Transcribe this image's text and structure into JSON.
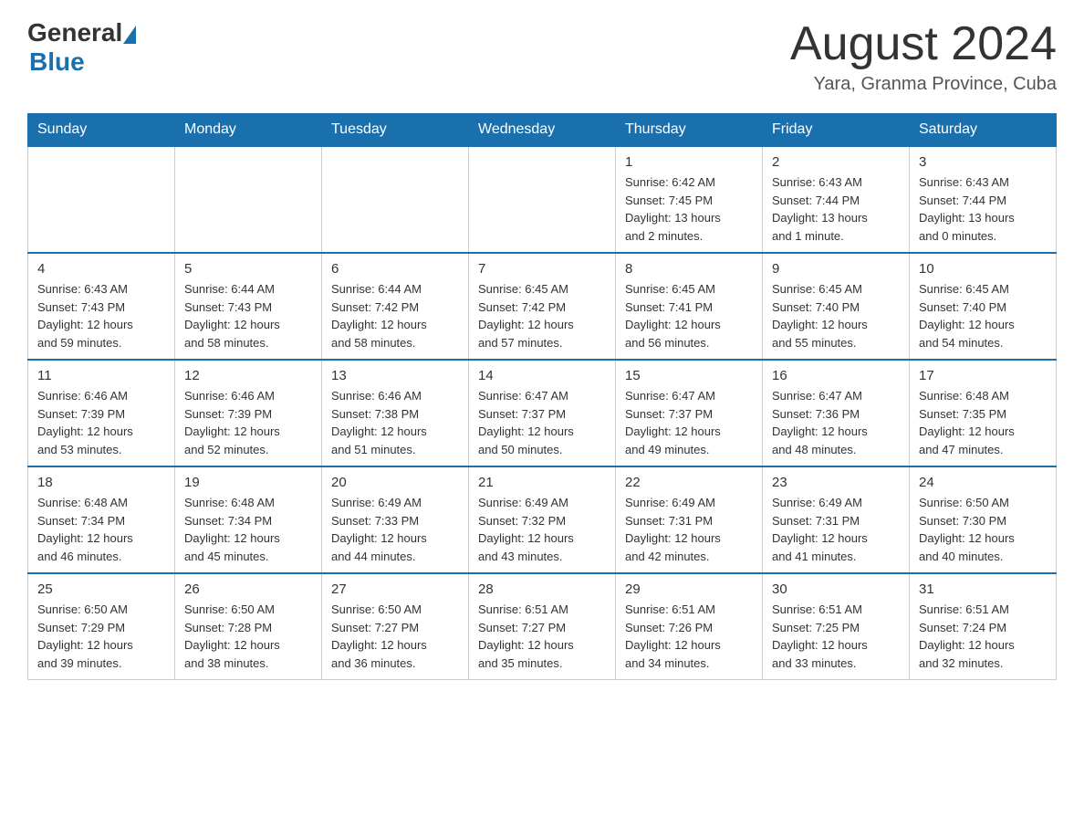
{
  "header": {
    "logo_general": "General",
    "logo_blue": "Blue",
    "month_title": "August 2024",
    "location": "Yara, Granma Province, Cuba"
  },
  "days_of_week": [
    "Sunday",
    "Monday",
    "Tuesday",
    "Wednesday",
    "Thursday",
    "Friday",
    "Saturday"
  ],
  "weeks": [
    {
      "days": [
        {
          "num": "",
          "info": ""
        },
        {
          "num": "",
          "info": ""
        },
        {
          "num": "",
          "info": ""
        },
        {
          "num": "",
          "info": ""
        },
        {
          "num": "1",
          "info": "Sunrise: 6:42 AM\nSunset: 7:45 PM\nDaylight: 13 hours\nand 2 minutes."
        },
        {
          "num": "2",
          "info": "Sunrise: 6:43 AM\nSunset: 7:44 PM\nDaylight: 13 hours\nand 1 minute."
        },
        {
          "num": "3",
          "info": "Sunrise: 6:43 AM\nSunset: 7:44 PM\nDaylight: 13 hours\nand 0 minutes."
        }
      ]
    },
    {
      "days": [
        {
          "num": "4",
          "info": "Sunrise: 6:43 AM\nSunset: 7:43 PM\nDaylight: 12 hours\nand 59 minutes."
        },
        {
          "num": "5",
          "info": "Sunrise: 6:44 AM\nSunset: 7:43 PM\nDaylight: 12 hours\nand 58 minutes."
        },
        {
          "num": "6",
          "info": "Sunrise: 6:44 AM\nSunset: 7:42 PM\nDaylight: 12 hours\nand 58 minutes."
        },
        {
          "num": "7",
          "info": "Sunrise: 6:45 AM\nSunset: 7:42 PM\nDaylight: 12 hours\nand 57 minutes."
        },
        {
          "num": "8",
          "info": "Sunrise: 6:45 AM\nSunset: 7:41 PM\nDaylight: 12 hours\nand 56 minutes."
        },
        {
          "num": "9",
          "info": "Sunrise: 6:45 AM\nSunset: 7:40 PM\nDaylight: 12 hours\nand 55 minutes."
        },
        {
          "num": "10",
          "info": "Sunrise: 6:45 AM\nSunset: 7:40 PM\nDaylight: 12 hours\nand 54 minutes."
        }
      ]
    },
    {
      "days": [
        {
          "num": "11",
          "info": "Sunrise: 6:46 AM\nSunset: 7:39 PM\nDaylight: 12 hours\nand 53 minutes."
        },
        {
          "num": "12",
          "info": "Sunrise: 6:46 AM\nSunset: 7:39 PM\nDaylight: 12 hours\nand 52 minutes."
        },
        {
          "num": "13",
          "info": "Sunrise: 6:46 AM\nSunset: 7:38 PM\nDaylight: 12 hours\nand 51 minutes."
        },
        {
          "num": "14",
          "info": "Sunrise: 6:47 AM\nSunset: 7:37 PM\nDaylight: 12 hours\nand 50 minutes."
        },
        {
          "num": "15",
          "info": "Sunrise: 6:47 AM\nSunset: 7:37 PM\nDaylight: 12 hours\nand 49 minutes."
        },
        {
          "num": "16",
          "info": "Sunrise: 6:47 AM\nSunset: 7:36 PM\nDaylight: 12 hours\nand 48 minutes."
        },
        {
          "num": "17",
          "info": "Sunrise: 6:48 AM\nSunset: 7:35 PM\nDaylight: 12 hours\nand 47 minutes."
        }
      ]
    },
    {
      "days": [
        {
          "num": "18",
          "info": "Sunrise: 6:48 AM\nSunset: 7:34 PM\nDaylight: 12 hours\nand 46 minutes."
        },
        {
          "num": "19",
          "info": "Sunrise: 6:48 AM\nSunset: 7:34 PM\nDaylight: 12 hours\nand 45 minutes."
        },
        {
          "num": "20",
          "info": "Sunrise: 6:49 AM\nSunset: 7:33 PM\nDaylight: 12 hours\nand 44 minutes."
        },
        {
          "num": "21",
          "info": "Sunrise: 6:49 AM\nSunset: 7:32 PM\nDaylight: 12 hours\nand 43 minutes."
        },
        {
          "num": "22",
          "info": "Sunrise: 6:49 AM\nSunset: 7:31 PM\nDaylight: 12 hours\nand 42 minutes."
        },
        {
          "num": "23",
          "info": "Sunrise: 6:49 AM\nSunset: 7:31 PM\nDaylight: 12 hours\nand 41 minutes."
        },
        {
          "num": "24",
          "info": "Sunrise: 6:50 AM\nSunset: 7:30 PM\nDaylight: 12 hours\nand 40 minutes."
        }
      ]
    },
    {
      "days": [
        {
          "num": "25",
          "info": "Sunrise: 6:50 AM\nSunset: 7:29 PM\nDaylight: 12 hours\nand 39 minutes."
        },
        {
          "num": "26",
          "info": "Sunrise: 6:50 AM\nSunset: 7:28 PM\nDaylight: 12 hours\nand 38 minutes."
        },
        {
          "num": "27",
          "info": "Sunrise: 6:50 AM\nSunset: 7:27 PM\nDaylight: 12 hours\nand 36 minutes."
        },
        {
          "num": "28",
          "info": "Sunrise: 6:51 AM\nSunset: 7:27 PM\nDaylight: 12 hours\nand 35 minutes."
        },
        {
          "num": "29",
          "info": "Sunrise: 6:51 AM\nSunset: 7:26 PM\nDaylight: 12 hours\nand 34 minutes."
        },
        {
          "num": "30",
          "info": "Sunrise: 6:51 AM\nSunset: 7:25 PM\nDaylight: 12 hours\nand 33 minutes."
        },
        {
          "num": "31",
          "info": "Sunrise: 6:51 AM\nSunset: 7:24 PM\nDaylight: 12 hours\nand 32 minutes."
        }
      ]
    }
  ]
}
